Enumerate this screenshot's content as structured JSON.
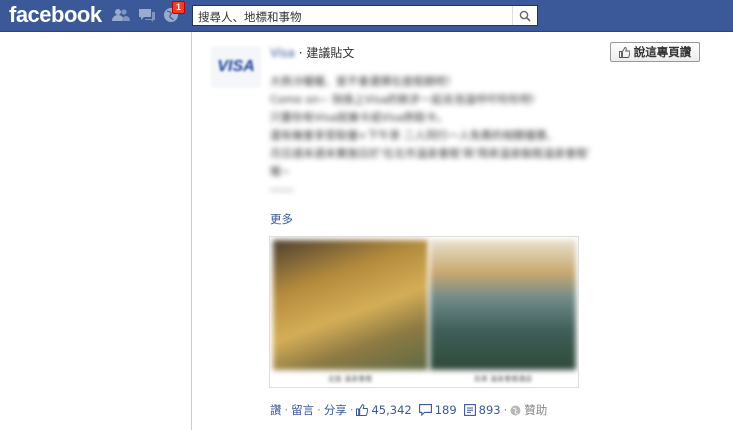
{
  "topbar": {
    "logo_text": "facebook",
    "notification_count": "1",
    "search": {
      "placeholder": "搜尋人、地標和事物"
    },
    "icons": [
      "friend-requests-icon",
      "messages-icon",
      "notifications-globe-icon",
      "search-icon"
    ]
  },
  "post": {
    "actor_name": "Visa",
    "separator": "·",
    "suggested_label": "建議貼文",
    "like_page_label": "說這專頁讚",
    "logo_text": "VISA",
    "body_lines": [
      "大熱冷暖暖、是不會選擇在度假期吧！",
      "Come on~ 快換上Visa的新步一起去泡溫呼吁吹吹吧!",
      "只要你有Visa就擁卡成Visa熱取卡。",
      "還有機會享受取優+下午茶 二人同行一人免費的相關優惠、",
      "月日週末週末實施日於'在北市溫泉會館'與'飛來溫泉飯館溫泉會館'",
      "喔~",
      "------"
    ],
    "more_label": "更多",
    "photo_captions": [
      "北投 溫泉會館",
      "烏來 溫泉會館酒店"
    ],
    "actions": {
      "like": "讚",
      "comment": "留言",
      "share": "分享",
      "dot": "·"
    },
    "counts": {
      "likes": "45,342",
      "comments": "189",
      "shares": "893"
    },
    "sponsored_label": "贊助"
  }
}
